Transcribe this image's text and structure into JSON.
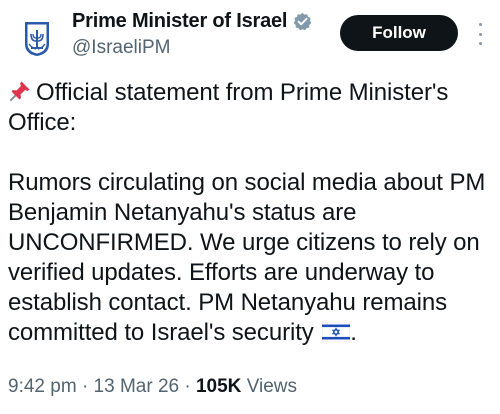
{
  "account": {
    "display_name": "Prime Minister of Israel",
    "handle": "@IsraeliPM",
    "verified": true
  },
  "follow_button": {
    "label": "Follow"
  },
  "post": {
    "line1": "Official statement from Prime Minister's Office:",
    "line2": "Rumors circulating on social media about PM Benjamin Netanyahu's status are UNCONFIRMED. We urge citizens to rely on verified updates. Efforts are underway to establish contact. PM Netanyahu remains committed to Israel's security",
    "line2_end": "."
  },
  "meta": {
    "time": "9:42 pm",
    "date": "13 Mar 26",
    "views_count": "105K",
    "views_label": "Views"
  },
  "icons": {
    "pin": "pushpin-icon",
    "flag": "israel-flag-icon",
    "verified": "verified-badge-icon",
    "more": "more-options-icon"
  },
  "colors": {
    "verified_badge": "#829aab",
    "follow_bg": "#0f1419",
    "secondary_text": "#536471",
    "emblem_blue": "#2a5aa8"
  }
}
